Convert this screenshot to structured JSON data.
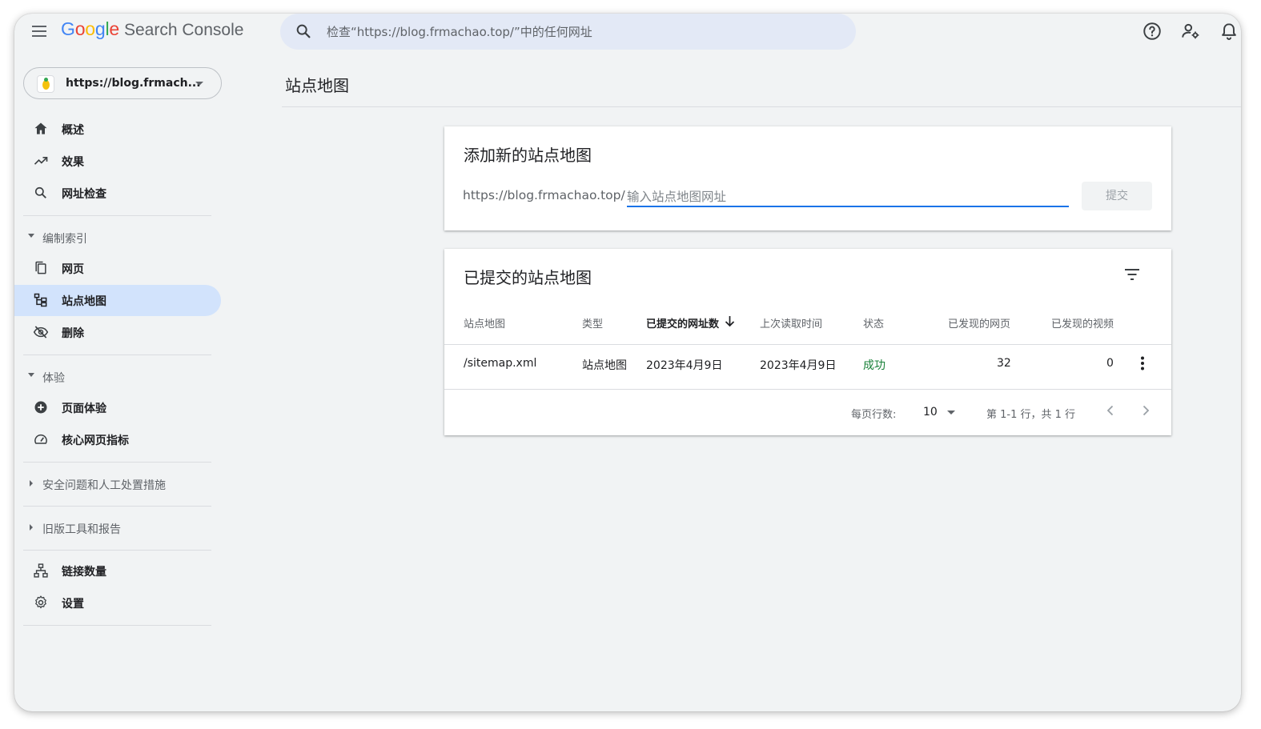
{
  "header": {
    "app_name": "Search Console",
    "search_placeholder": "检查“https://blog.frmachao.top/”中的任何网址"
  },
  "sidebar": {
    "property": "https://blog.frmach...",
    "items_top": [
      {
        "label": "概述",
        "icon": "home-icon"
      },
      {
        "label": "效果",
        "icon": "trending-up-icon"
      },
      {
        "label": "网址检查",
        "icon": "search-icon"
      }
    ],
    "section_index": {
      "title": "编制索引",
      "items": [
        {
          "label": "网页",
          "icon": "file-copy-icon"
        },
        {
          "label": "站点地图",
          "icon": "sitemap-icon",
          "active": true
        },
        {
          "label": "删除",
          "icon": "visibility-off-icon"
        }
      ]
    },
    "section_experience": {
      "title": "体验",
      "items": [
        {
          "label": "页面体验",
          "icon": "add-circle-icon"
        },
        {
          "label": "核心网页指标",
          "icon": "speed-icon"
        }
      ]
    },
    "section_security": {
      "title": "安全问题和人工处置措施"
    },
    "section_legacy": {
      "title": "旧版工具和报告"
    },
    "items_bottom": [
      {
        "label": "链接数量",
        "icon": "links-icon"
      },
      {
        "label": "设置",
        "icon": "gear-icon"
      }
    ]
  },
  "main": {
    "page_title": "站点地图",
    "add_card": {
      "title": "添加新的站点地图",
      "prefix": "https://blog.frmachao.top/",
      "input_placeholder": "输入站点地图网址",
      "submit_label": "提交"
    },
    "submitted_card": {
      "title": "已提交的站点地图",
      "columns": [
        "站点地图",
        "类型",
        "已提交的网址数",
        "上次读取时间",
        "状态",
        "已发现的网页",
        "已发现的视频"
      ],
      "rows": [
        {
          "sitemap": "/sitemap.xml",
          "type": "站点地图",
          "submitted": "2023年4月9日",
          "last_read": "2023年4月9日",
          "status": "成功",
          "pages": "32",
          "videos": "0"
        }
      ],
      "pagination": {
        "rows_per_page_label": "每页行数:",
        "rows_per_page": "10",
        "range_text": "第 1-1 行，共 1 行"
      }
    }
  },
  "colors": {
    "accent": "#1a73e8",
    "active_nav": "#d2e3fc",
    "success": "#188038",
    "background": "#f1f3f4"
  }
}
